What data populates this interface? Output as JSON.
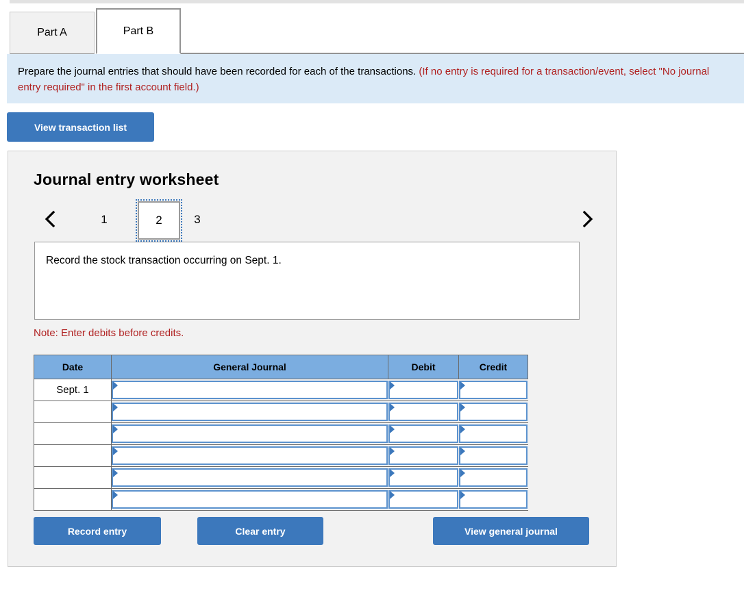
{
  "tabs": [
    {
      "label": "Part A",
      "active": false
    },
    {
      "label": "Part B",
      "active": true
    }
  ],
  "banner": {
    "text_black": "Prepare the journal entries that should have been recorded for each of the transactions.",
    "text_red": "(If no entry is required for a transaction/event, select \"No journal entry required\" in the first account field.)",
    "background_color": "#dbeaf7",
    "note_color": "#b02020"
  },
  "toolbar": {
    "view_transaction_list_label": "View transaction list"
  },
  "worksheet": {
    "title": "Journal entry worksheet",
    "pager": {
      "prev_icon": "chevron-left-icon",
      "next_icon": "chevron-right-icon",
      "pages": [
        "1",
        "2",
        "3"
      ],
      "current_page": "2"
    },
    "description": "Record the stock transaction occurring on Sept. 1.",
    "note": "Note: Enter debits before credits.",
    "table": {
      "headers": [
        "Date",
        "General Journal",
        "Debit",
        "Credit"
      ],
      "header_color": "#7bade0",
      "rows": [
        {
          "date": "Sept. 1",
          "general_journal": "",
          "debit": "",
          "credit": ""
        },
        {
          "date": "",
          "general_journal": "",
          "debit": "",
          "credit": ""
        },
        {
          "date": "",
          "general_journal": "",
          "debit": "",
          "credit": ""
        },
        {
          "date": "",
          "general_journal": "",
          "debit": "",
          "credit": ""
        },
        {
          "date": "",
          "general_journal": "",
          "debit": "",
          "credit": ""
        },
        {
          "date": "",
          "general_journal": "",
          "debit": "",
          "credit": ""
        }
      ]
    },
    "buttons": {
      "record_entry": "Record entry",
      "clear_entry": "Clear entry",
      "view_general_journal": "View general journal",
      "color": "#3c78bc"
    }
  }
}
